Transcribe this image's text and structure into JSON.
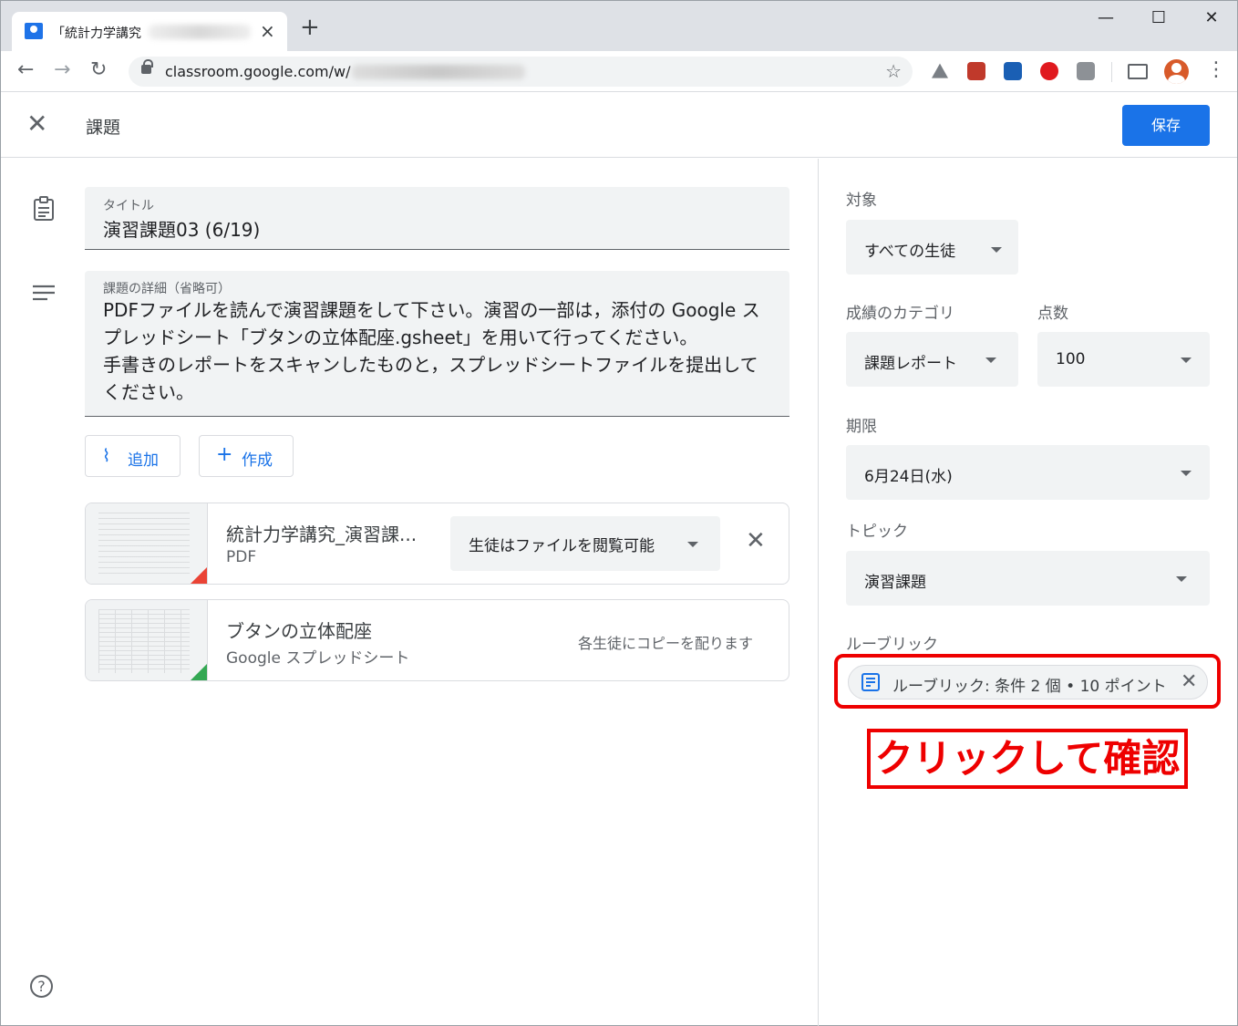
{
  "browser": {
    "tab_title": "「統計力学講究",
    "tab_close": "×",
    "new_tab": "+",
    "win_min": "—",
    "win_max": "☐",
    "win_close": "✕",
    "back": "←",
    "forward": "→",
    "reload": "↻",
    "url": "classroom.google.com/w/",
    "bookmark_star": "☆",
    "menu": "⋮"
  },
  "header": {
    "close": "✕",
    "title": "課題",
    "save_label": "保存"
  },
  "form": {
    "title_label": "タイトル",
    "title_value": "演習課題03 (6/19)",
    "details_label": "課題の詳細（省略可）",
    "details_lines": [
      "PDFファイルを読んで演習課題をして下さい。演習の一部は，添付の Google ス",
      "プレッドシート「ブタンの立体配座.gsheet」を用いて行ってください。",
      "手書きのレポートをスキャンしたものと，スプレッドシートファイルを提出して",
      "ください。"
    ],
    "add_label": "追加",
    "create_label": "作成"
  },
  "attachments": [
    {
      "title": "統計力学講究_演習課...",
      "type": "PDF",
      "permission": "生徒はファイルを閲覧可能",
      "remove": "✕",
      "accent": "#ea4335"
    },
    {
      "title": "ブタンの立体配座",
      "type": "Google スプレッドシート",
      "note": "各生徒にコピーを配ります",
      "accent": "#34a853"
    }
  ],
  "panel": {
    "for_label": "対象",
    "for_value": "すべての生徒",
    "category_label": "成績のカテゴリ",
    "category_value": "課題レポート",
    "points_label": "点数",
    "points_value": "100",
    "due_label": "期限",
    "due_value": "6月24日(水)",
    "topic_label": "トピック",
    "topic_value": "演習課題",
    "rubric_label": "ルーブリック",
    "rubric_chip": "ルーブリック: 条件 2 個 • 10 ポイント",
    "rubric_remove": "✕"
  },
  "annotation": {
    "callout": "クリックして確認",
    "color": "#ee0000"
  },
  "colors": {
    "accent": "#1a73e8",
    "field_bg": "#f1f3f4"
  }
}
